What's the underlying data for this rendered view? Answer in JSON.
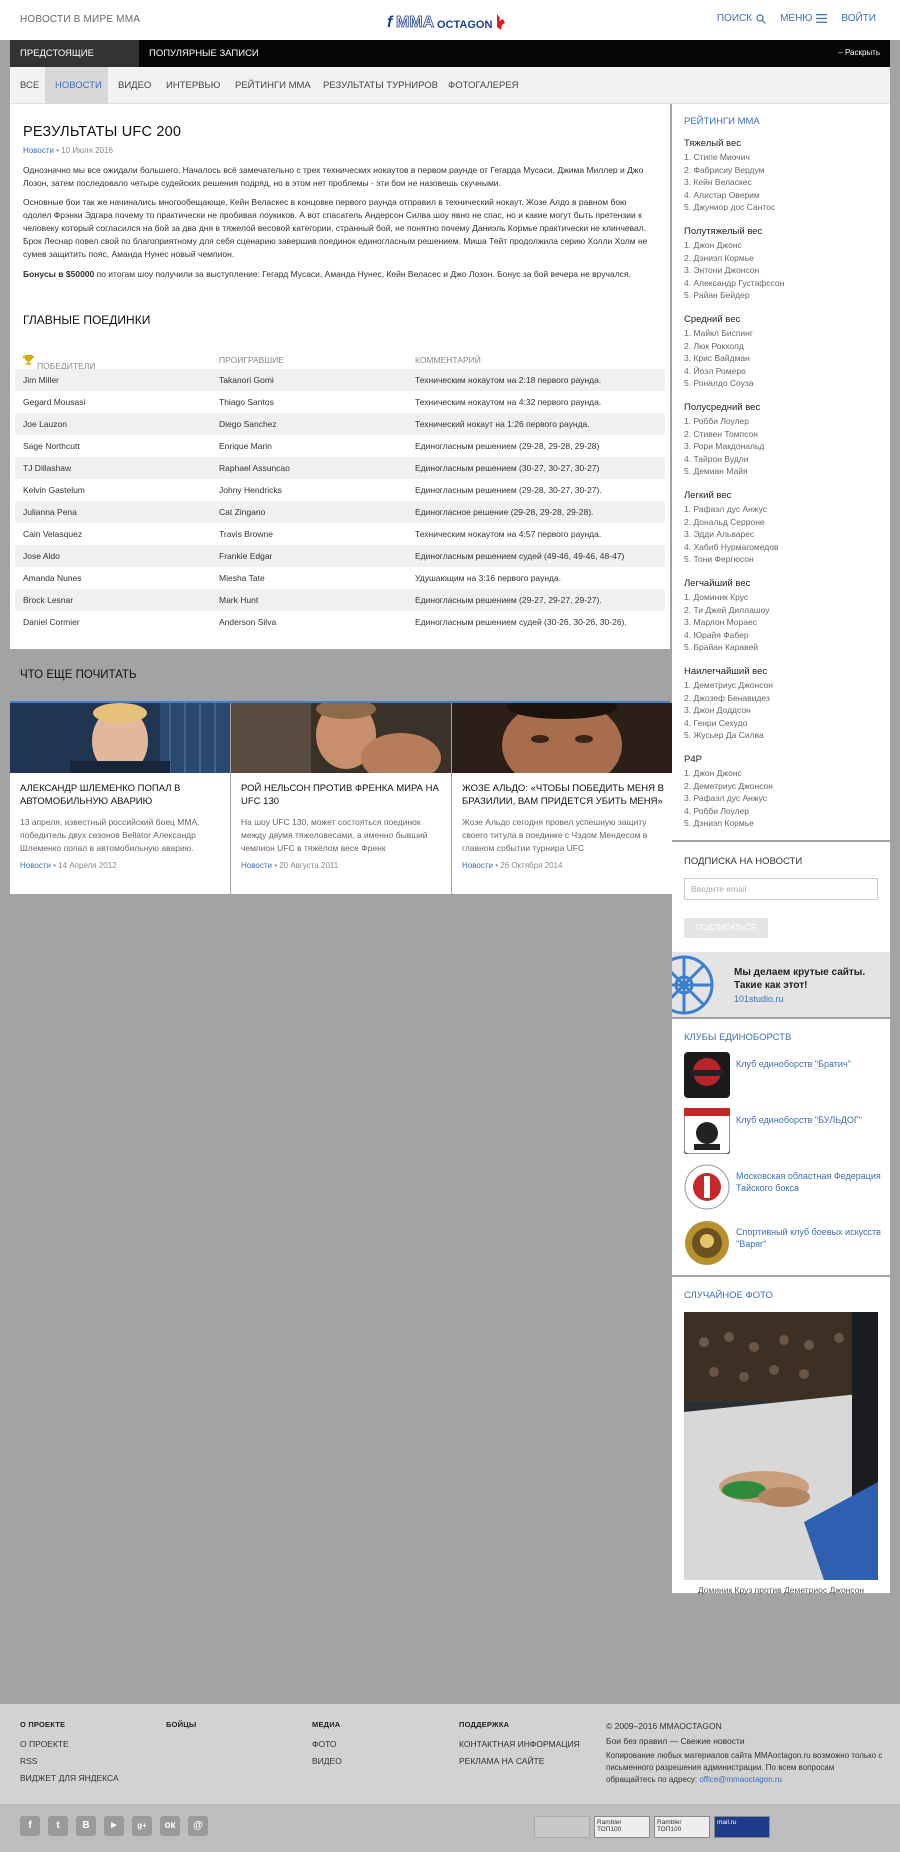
{
  "header": {
    "left": "НОВОСТИ В МИРЕ ММА",
    "search": "ПОИСК",
    "menu": "МЕНЮ",
    "login": "ВОЙТИ"
  },
  "tabs": [
    "ПРЕДСТОЯЩИЕ СОБЫТИЯ",
    "ПОПУЛЯРНЫЕ ЗАПИСИ"
  ],
  "expand": "– Раскрыть",
  "categories": [
    "ВСЕ",
    "НОВОСТИ",
    "ВИДЕО",
    "ИНТЕРВЬЮ",
    "РЕЙТИНГИ ММА",
    "РЕЗУЛЬТАТЫ ТУРНИРОВ",
    "ФОТОГАЛЕРЕЯ"
  ],
  "article": {
    "title": "РЕЗУЛЬТАТЫ UFC 200",
    "category": "Новости",
    "date": " • 10 Июля 2016",
    "p1": "Однозначно мы все ожидали большего. Началось всё замечательно с трех технических нокаутов в первом раунде от Гегарда Мусаси, Джима Миллер и Джо Лозон, затем последовало четыре судейских решения подряд, но в этом нет проблемы - эти бои не назовешь скучными.",
    "p2": "Основные бои так же начинались многообещающе, Кейн Веласкес в концовке первого раунда отправил в технический нокаут. Жозе Алдо в равном бою одолел Фрэнки Эдгара почему то практически не пробивая лоукиков. А вот спасатель Андерсон Силва шоу явно не спас, но и какие могут быть претензии к человеку который согласился на бой за два дня в тяжелой весовой категории, странный бой, не понятно почему Даниэль Кормье практически не клинчевал. Брок Леснар повел свой по благоприятному для себя сценарию завершив поединок единогласным решением. Миша Тейт продолжила серию Холли Холм не сумев защитить пояс, Аманда Нунес новый чемпион.",
    "bonus_bold": "Бонусы в $50000",
    "bonus_rest": " по итогам шоу получили за выступление: Гегард Мусаси, Аманда Нунес, Кейн Веласес и Джо Лозон. Бонус за бой вечера не вручался.",
    "main_fights": "ГЛАВНЫЕ ПОЕДИНКИ"
  },
  "fights": {
    "headers": [
      "ПОБЕДИТЕЛИ",
      "ПРОИГРАВШИЕ",
      "КОММЕНТАРИЙ"
    ],
    "rows": [
      [
        "Jim Miller",
        "Takanori Gomi",
        "Техническим нокаутом на 2:18 первого раунда."
      ],
      [
        "Gegard Mousasi",
        "Thiago Santos",
        "Техническим нокаутом на 4:32 первого раунда."
      ],
      [
        "Joe Lauzon",
        "Diego Sanchez",
        "Технический нокаут на 1:26 первого раунда."
      ],
      [
        "Sage Northcutt",
        "Enrique Marin",
        "Единогласным решением (29-28, 29-28, 29-28)"
      ],
      [
        "TJ Dillashaw",
        "Raphael Assuncao",
        "Единогласным решением (30-27, 30-27, 30-27)"
      ],
      [
        "Kelvin Gastelum",
        "Johny Hendricks",
        "Единогласным решением (29-28, 30-27, 30-27)."
      ],
      [
        "Julianna Pena",
        "Cat Zingano",
        "Единогласное решение (29-28, 29-28, 29-28)."
      ],
      [
        "Cain Velasquez",
        "Travis Browne",
        "Техническим нокаутом на 4:57 первого раунда."
      ],
      [
        "Jose Aldo",
        "Frankie Edgar",
        "Единогласным решением судей (49-46, 49-46, 48-47)"
      ],
      [
        "Amanda Nunes",
        "Miesha Tate",
        "Удушающим на 3:16 первого раунда."
      ],
      [
        "Brock Lesnar",
        "Mark Hunt",
        "Единогласным решением (29-27, 29-27, 29-27)."
      ],
      [
        "Daniel Cormier",
        "Anderson Silva",
        "Единогласным решением судей (30-26, 30-26, 30-26)."
      ]
    ]
  },
  "more": {
    "title": "ЧТО ЕЩЕ ПОЧИТАТЬ",
    "cards": [
      {
        "title": "АЛЕКСАНДР ШЛЕМЕНКО ПОПАЛ В АВТОМОБИЛЬНУЮ АВАРИЮ",
        "desc": "13 апреля, известный российский боец ММА, победитель двух сезонов Bellator Александр Шлеменко попал в автомобильную аварию.",
        "cat": "Новости",
        "date": " • 14 Апреля 2012"
      },
      {
        "title": "РОЙ НЕЛЬСОН ПРОТИВ ФРЕНКА МИРА НА UFC 130",
        "desc": "На шоу UFC 130, может состояться поединок между двумя тяжеловесами, а именно бывший чемпион UFC в тяжёлом весе Френк",
        "cat": "Новости",
        "date": " • 20 Августа 2011"
      },
      {
        "title": "ЖОЗЕ АЛЬДО: «ЧТОБЫ ПОБЕДИТЬ МЕНЯ В БРАЗИЛИИ, ВАМ ПРИДЕТСЯ УБИТЬ МЕНЯ»",
        "desc": "Жозе Альдо сегодня провел успешную защиту своего титула в поединке с Чэдом Мендесом в главном событии турнира UFC",
        "cat": "Новости",
        "date": " • 26 Октября 2014"
      }
    ]
  },
  "ratings": {
    "title": "РЕЙТИНГИ ММА",
    "classes": [
      {
        "name": "Тяжелый вес",
        "items": [
          "1. Стипе Миочич",
          "2. Фабрисиу Вердум",
          "3. Кейн Веласкес",
          "4. Алистар Оверим",
          "5. Джуниор дос Сантос"
        ]
      },
      {
        "name": "Полутяжелый вес",
        "items": [
          "1. Джон Джонс",
          "2. Дэниэл Кормье",
          "3. Энтони Джонсон",
          "4. Александр Густафссон",
          "5. Райан Бейдер"
        ]
      },
      {
        "name": "Средний вес",
        "items": [
          "1. Майкл Биспинг",
          "2. Люк Рокхолд",
          "3. Крис Вайдман",
          "4. Йоэл Ромеро",
          "5. Роналдо Соуза"
        ]
      },
      {
        "name": "Полусредний вес",
        "items": [
          "1. Робби Лоулер",
          "2. Стивен Томпсон",
          "3. Рори Макдональд",
          "4. Тайрон Вудли",
          "5. Демиан Майя"
        ]
      },
      {
        "name": "Легкий вес",
        "items": [
          "1. Рафаэл дус Анжус",
          "2. Дональд Серроне",
          "3. Эдди Альварес",
          "4. Хабиб Нурмагомедов",
          "5. Тони Фергюсон"
        ]
      },
      {
        "name": "Легчайший вес",
        "items": [
          "1. Доминик Крус",
          "2. Ти Джей Диллашоу",
          "3. Марлон Морaес",
          "4. Юрайя Фабер",
          "5. Брайан Каравей"
        ]
      },
      {
        "name": "Наилегчайший вес",
        "items": [
          "1. Деметриус Джонсон",
          "2. Джозеф Бенавидез",
          "3. Джон Доддсон",
          "4. Генри Сехудо",
          "5. Жусьер Да Силва"
        ]
      },
      {
        "name": "P4P",
        "items": [
          "1. Джон Джонс",
          "2. Деметриус Джонсон",
          "3. Рафаэл дус Анжус",
          "4. Робби Лоулер",
          "5. Дэниэл Кормье"
        ]
      }
    ]
  },
  "subscribe": {
    "title": "ПОДПИСКА НА НОВОСТИ",
    "placeholder": "Введите email",
    "button": "ПОДПИСАТЬСЯ"
  },
  "promo": {
    "text": "Мы делаем крутые сайты. Такие как этот!",
    "link": "101studio.ru"
  },
  "clubs": {
    "title": "КЛУБЫ ЕДИНОБОРСТВ",
    "items": [
      "Клуб единоборств \"Братич\"",
      "Клуб единоборств \"БУЛЬДОГ\"",
      "Московская областная Федерация Тайского бокса",
      "Спортивный клуб боевых искусств \"Варяг\""
    ]
  },
  "photo": {
    "title": "СЛУЧАЙНОЕ ФОТО",
    "caption": "Доминик Круз против Деметриос Джонсон"
  },
  "footer": {
    "cols": [
      {
        "h": "О ПРОЕКТЕ",
        "links": [
          "О ПРОЕКТЕ",
          "RSS",
          "ВИДЖЕТ ДЛЯ ЯНДЕКСА"
        ]
      },
      {
        "h": "БОЙЦЫ",
        "links": []
      },
      {
        "h": "МЕДИА",
        "links": [
          "ФОТО",
          "ВИДЕО"
        ]
      },
      {
        "h": "ПОДДЕРЖКА",
        "links": [
          "КОНТАКТНАЯ ИНФОРМАЦИЯ",
          "РЕКЛАМА НА САЙТЕ"
        ]
      }
    ],
    "copyright": "© 2009–2016 MMAOCTAGON",
    "tagline": "Бои без правил — Свежие новости",
    "notice": "Копирование любых материалов сайта MMAoctagon.ru возможно только с письменного разрешения администрации. По всем вопросам обращайтесь по адресу: ",
    "email": "office@mmaoctagon.ru",
    "counters": [
      "Rambler ТОП100",
      "Rambler ТОП100",
      "mail.ru"
    ]
  },
  "colors": {
    "accent": "#3b6fb6",
    "black": "#050505",
    "bg": "#a3a3a3"
  }
}
